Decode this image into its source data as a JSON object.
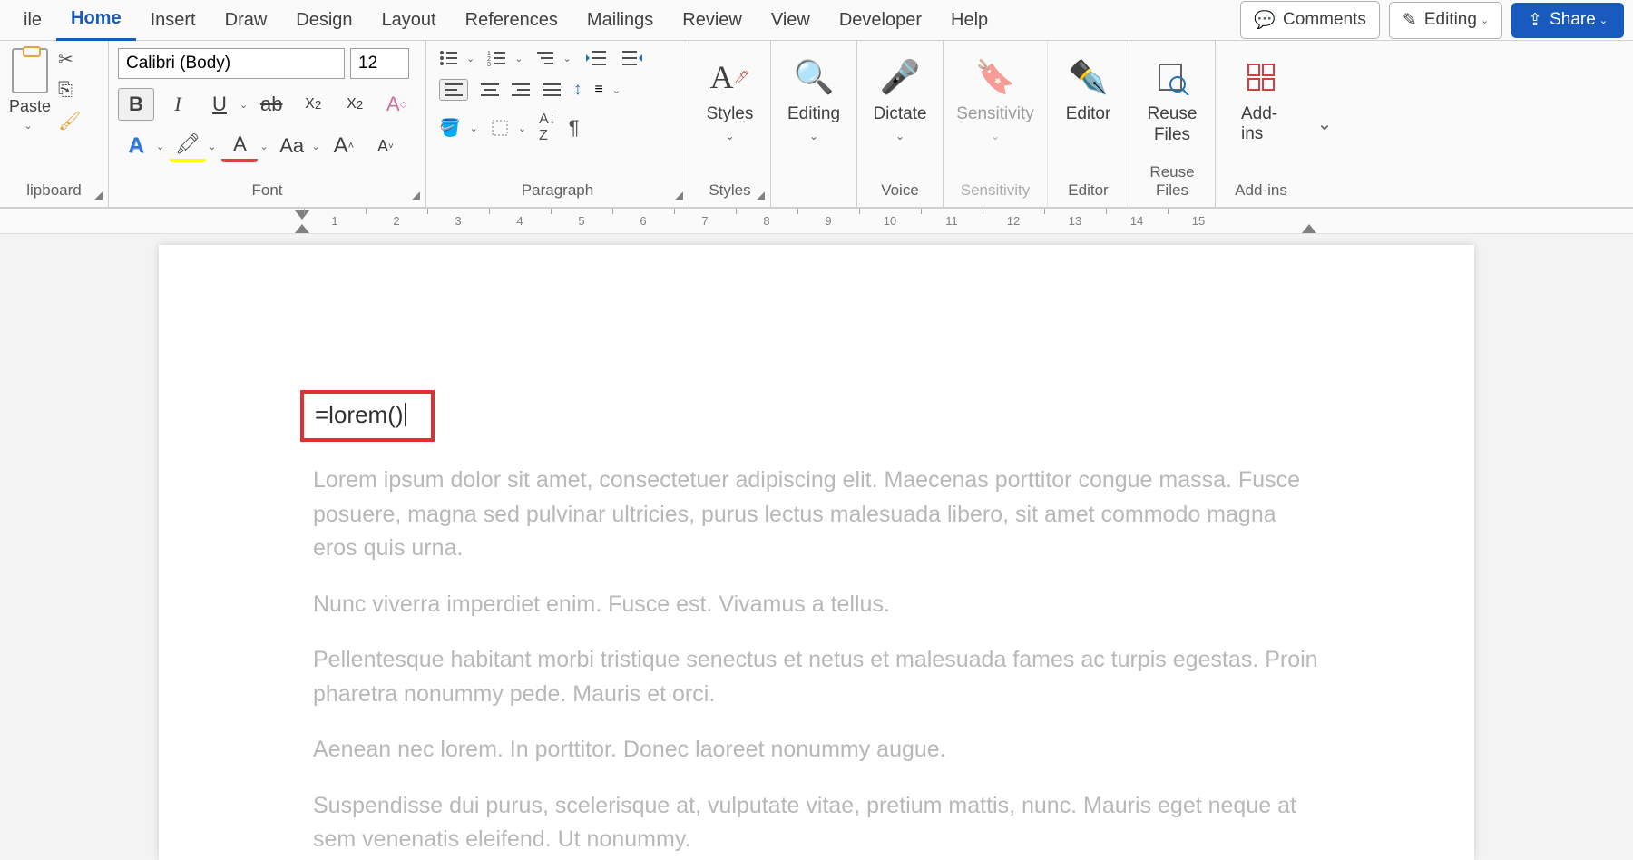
{
  "tabs": {
    "file": "ile",
    "home": "Home",
    "insert": "Insert",
    "draw": "Draw",
    "design": "Design",
    "layout": "Layout",
    "references": "References",
    "mailings": "Mailings",
    "review": "Review",
    "view": "View",
    "developer": "Developer",
    "help": "Help"
  },
  "header_buttons": {
    "comments": "Comments",
    "editing": "Editing",
    "share": "Share"
  },
  "ribbon": {
    "clipboard": {
      "label": "lipboard",
      "paste": "Paste"
    },
    "font": {
      "label": "Font",
      "name": "Calibri (Body)",
      "size": "12",
      "bold": "B",
      "italic": "I",
      "underline": "U",
      "strike": "ab",
      "sub": "X",
      "sup": "X",
      "clear": "A",
      "wordart": "A",
      "highlight": "A",
      "color": "A",
      "case": "Aa",
      "grow": "A",
      "shrink": "A"
    },
    "paragraph": {
      "label": "Paragraph"
    },
    "styles": {
      "label": "Styles",
      "btn": "Styles"
    },
    "editing": {
      "label": "",
      "btn": "Editing"
    },
    "voice": {
      "label": "Voice",
      "btn": "Dictate"
    },
    "sensitivity": {
      "label": "Sensitivity",
      "btn": "Sensitivity"
    },
    "editor": {
      "label": "Editor",
      "btn": "Editor"
    },
    "reuse": {
      "label": "Reuse Files",
      "btn": "Reuse Files"
    },
    "addins": {
      "label": "Add-ins",
      "btn": "Add-ins"
    }
  },
  "ruler": [
    "1",
    "2",
    "3",
    "4",
    "5",
    "6",
    "7",
    "8",
    "9",
    "10",
    "11",
    "12",
    "13",
    "14",
    "15"
  ],
  "document": {
    "formula": "=lorem()",
    "p1": "Lorem ipsum dolor sit amet, consectetuer adipiscing elit. Maecenas porttitor congue massa. Fusce posuere, magna sed pulvinar ultricies, purus lectus malesuada libero, sit amet commodo magna eros quis urna.",
    "p2": "Nunc viverra imperdiet enim. Fusce est. Vivamus a tellus.",
    "p3": "Pellentesque habitant morbi tristique senectus et netus et malesuada fames ac turpis egestas. Proin pharetra nonummy pede. Mauris et orci.",
    "p4": "Aenean nec lorem. In porttitor. Donec laoreet nonummy augue.",
    "p5": "Suspendisse dui purus, scelerisque at, vulputate vitae, pretium mattis, nunc. Mauris eget neque at sem venenatis eleifend. Ut nonummy."
  }
}
